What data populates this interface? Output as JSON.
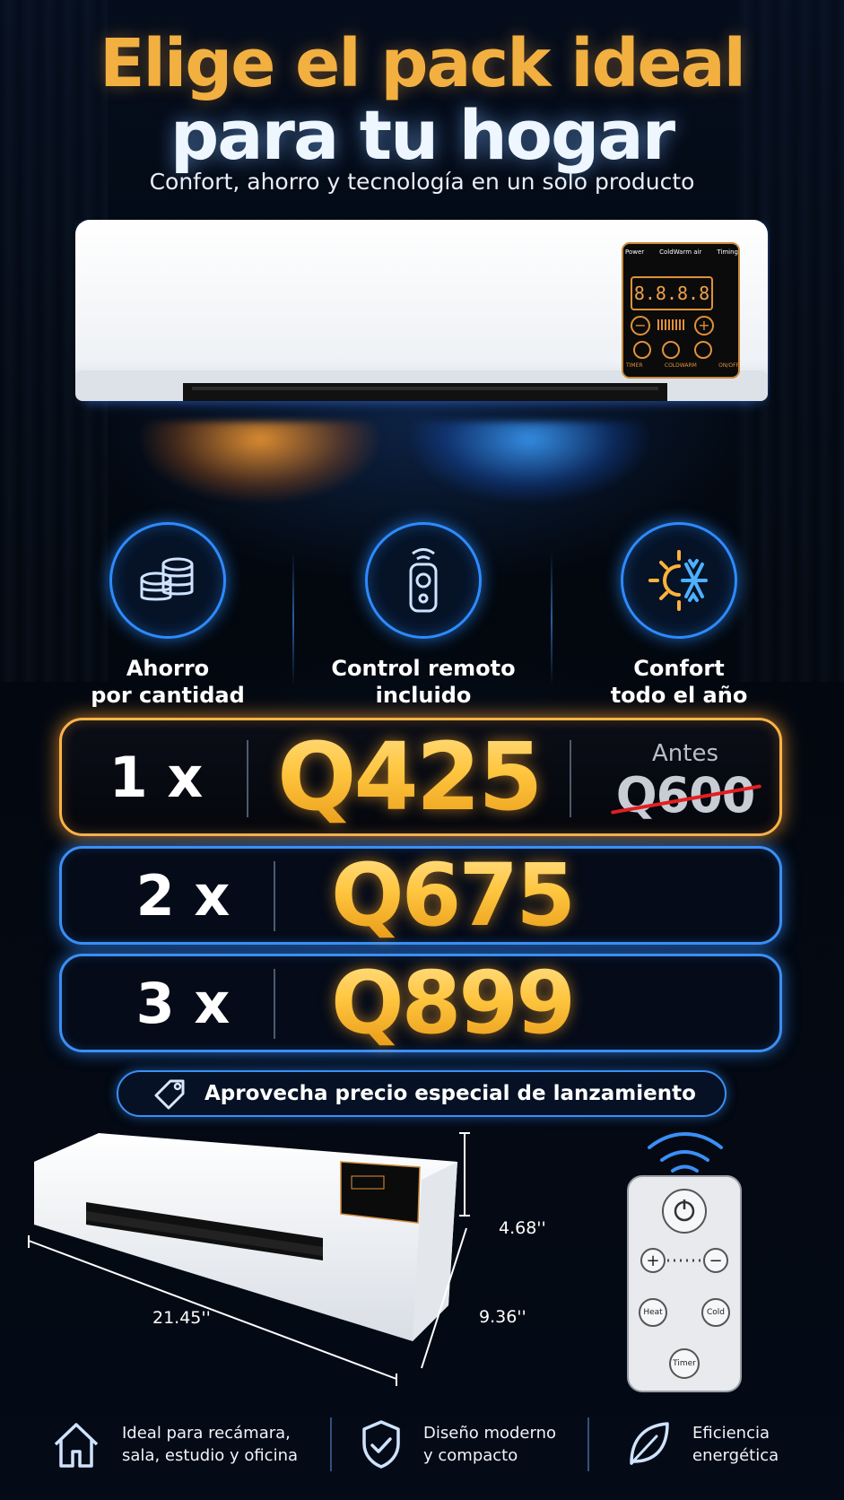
{
  "header": {
    "title_line1": "Elige el pack ideal",
    "title_line2": "para tu hogar",
    "subtitle": "Confort, ahorro y tecnología en un solo producto"
  },
  "device_panel": {
    "labels": [
      "Power",
      "ColdWarm air",
      "Timing"
    ],
    "display": "8.8.8.8",
    "buttons": [
      "TIMER",
      "COLDWARM",
      "ON/OFF"
    ]
  },
  "features": [
    {
      "line1": "Ahorro",
      "line2": "por cantidad",
      "icon": "coins-icon"
    },
    {
      "line1": "Control remoto",
      "line2": "incluido",
      "icon": "remote-control-icon"
    },
    {
      "line1": "Confort",
      "line2": "todo el año",
      "icon": "sun-snowflake-icon"
    }
  ],
  "pricing": [
    {
      "qty": "1 x",
      "price": "Q425",
      "before_label": "Antes",
      "before_price": "Q600",
      "highlight": true
    },
    {
      "qty": "2 x",
      "price": "Q675",
      "highlight": false
    },
    {
      "qty": "3 x",
      "price": "Q899",
      "highlight": false
    }
  ],
  "promo": {
    "text": "Aprovecha precio especial de lanzamiento",
    "icon": "price-tag-icon"
  },
  "dimensions": {
    "height": "4.68''",
    "depth": "9.36''",
    "width": "21.45''"
  },
  "remote": {
    "buttons": [
      "Heat",
      "Cold",
      "Timer"
    ]
  },
  "bottom_features": [
    {
      "line1": "Ideal para recámara,",
      "line2": "sala, estudio y oficina",
      "icon": "house-icon"
    },
    {
      "line1": "Diseño moderno",
      "line2": "y compacto",
      "icon": "shield-check-icon"
    },
    {
      "line1": "Eficiencia",
      "line2": "energética",
      "icon": "leaf-icon"
    }
  ],
  "colors": {
    "gold": "#f2b041",
    "blue_glow": "#3b8ff5",
    "orange_glow": "#ffb347",
    "background": "#030914",
    "strike": "#e02020"
  }
}
